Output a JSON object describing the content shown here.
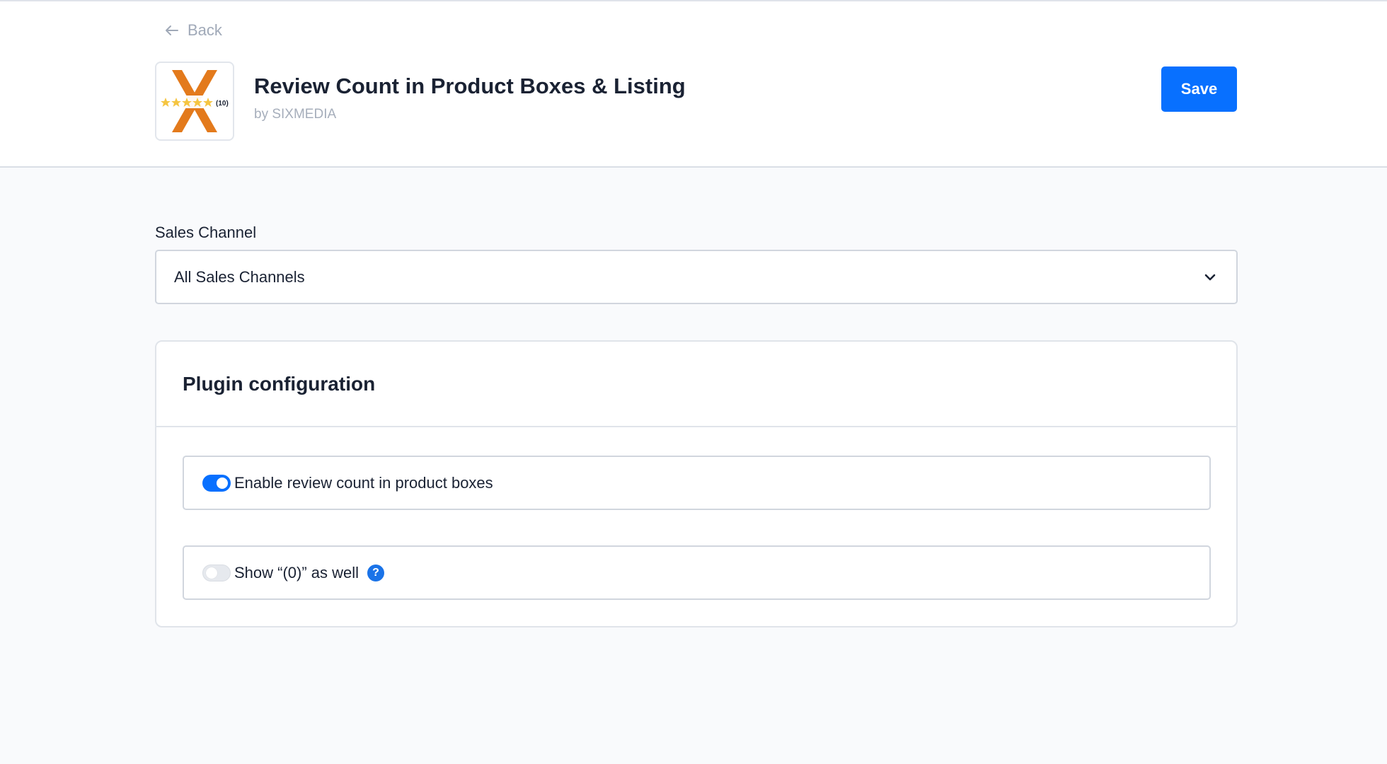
{
  "header": {
    "back_label": "Back",
    "title": "Review Count in Product Boxes & Listing",
    "author": "by SIXMEDIA",
    "save_label": "Save",
    "logo": {
      "icon": "plugin-logo-x-stars",
      "badge_text": "(10)",
      "accent_color": "#e37a1c",
      "star_color": "#f5c542"
    }
  },
  "sales_channel": {
    "label": "Sales Channel",
    "selected_value": "All Sales Channels"
  },
  "config_card": {
    "title": "Plugin configuration",
    "options": [
      {
        "label": "Enable review count in product boxes",
        "enabled": true
      },
      {
        "label": "Show “(0)” as well",
        "enabled": false,
        "help_icon": "?"
      }
    ]
  },
  "colors": {
    "primary": "#0870ff",
    "background": "#f9fafc",
    "text": "#1a2233",
    "muted": "#a6aebb"
  }
}
